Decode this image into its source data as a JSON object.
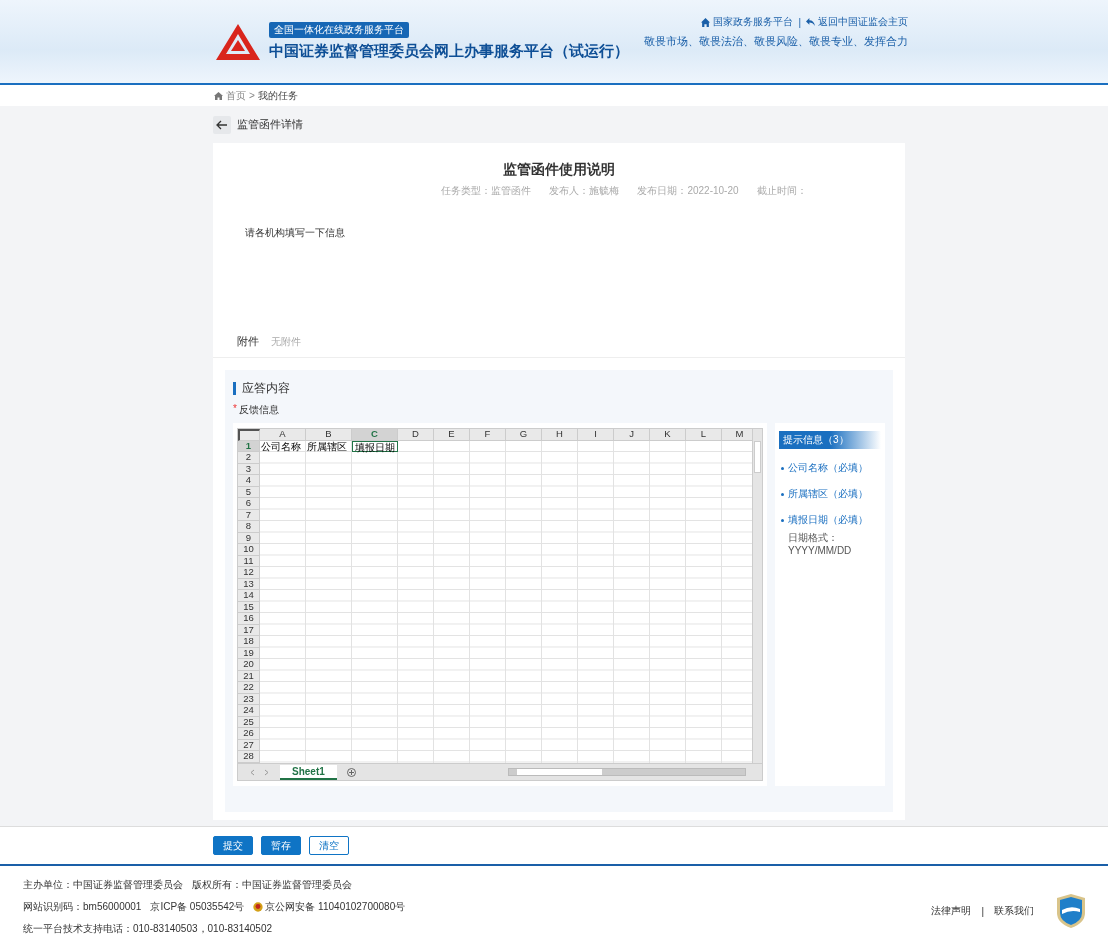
{
  "header": {
    "badge": "全国一体化在线政务服务平台",
    "title": "中国证券监督管理委员会网上办事服务平台（试运行）",
    "top_links": [
      {
        "text": "国家政务服务平台"
      },
      {
        "text": "返回中国证监会主页"
      }
    ],
    "link_separator": "|",
    "slogan": "敬畏市场、敬畏法治、敬畏风险、敬畏专业、发挥合力"
  },
  "breadcrumb": {
    "items": [
      "首页",
      "我的任务"
    ],
    "separator": ">"
  },
  "page_title": "监管函件详情",
  "notice": {
    "title": "监管函件使用说明",
    "meta": [
      "任务类型：监管函件",
      "发布人：施毓梅",
      "发布日期：2022-10-20",
      "截止时间："
    ],
    "body": "请各机构填写一下信息",
    "attachments_label": "附件",
    "attachments_value": "无附件"
  },
  "response": {
    "heading": "应答内容",
    "required_mark": "*",
    "field_label": "反馈信息",
    "sheet": {
      "columns": [
        "A",
        "B",
        "C",
        "D",
        "E",
        "F",
        "G",
        "H",
        "I",
        "J",
        "K",
        "L",
        "M"
      ],
      "rows": [
        {
          "header": "1",
          "cells": [
            {
              "text": "公司名称",
              "selected": false
            },
            {
              "text": "所属辖区",
              "selected": false
            },
            {
              "text": "填报日期",
              "selected": true
            }
          ]
        },
        {
          "header": "2",
          "cells": []
        },
        {
          "header": "3",
          "cells": []
        },
        {
          "header": "4",
          "cells": []
        },
        {
          "header": "5",
          "cells": []
        },
        {
          "header": "6",
          "cells": []
        },
        {
          "header": "7",
          "cells": []
        },
        {
          "header": "8",
          "cells": []
        },
        {
          "header": "9",
          "cells": []
        },
        {
          "header": "10",
          "cells": []
        },
        {
          "header": "11",
          "cells": []
        },
        {
          "header": "12",
          "cells": []
        },
        {
          "header": "13",
          "cells": []
        },
        {
          "header": "14",
          "cells": []
        },
        {
          "header": "15",
          "cells": []
        },
        {
          "header": "16",
          "cells": []
        },
        {
          "header": "17",
          "cells": []
        },
        {
          "header": "18",
          "cells": []
        },
        {
          "header": "19",
          "cells": []
        },
        {
          "header": "20",
          "cells": []
        },
        {
          "header": "21",
          "cells": []
        },
        {
          "header": "22",
          "cells": []
        },
        {
          "header": "23",
          "cells": []
        },
        {
          "header": "24",
          "cells": []
        },
        {
          "header": "25",
          "cells": []
        },
        {
          "header": "26",
          "cells": []
        },
        {
          "header": "27",
          "cells": []
        },
        {
          "header": "28",
          "cells": []
        }
      ],
      "tabs": [
        {
          "label": "Sheet1",
          "selected": true
        }
      ]
    },
    "hints": {
      "title": "提示信息（3）",
      "items": [
        {
          "text": "公司名称（必填）"
        },
        {
          "text": "所属辖区（必填）"
        },
        {
          "text": "填报日期（必填）",
          "note": "日期格式：YYYY/MM/DD"
        }
      ]
    }
  },
  "actions": [
    {
      "label": "提交",
      "kind": "primary"
    },
    {
      "label": "暂存",
      "kind": "primary"
    },
    {
      "label": "清空",
      "kind": "outline"
    }
  ],
  "footer": {
    "lines": [
      {
        "items": [
          {
            "text": "主办单位：中国证券监督管理委员会"
          },
          {
            "text": "版权所有：中国证券监督管理委员会"
          }
        ]
      },
      {
        "items": [
          {
            "text": "网站识别码：bm56000001"
          },
          {
            "text": "京ICP备 05035542号"
          },
          {
            "text": "京公网安备 11040102700080号",
            "kind": "emblem"
          }
        ]
      },
      {
        "items": [
          {
            "text": "统一平台技术支持电话：010-83140503，010-83140502"
          }
        ]
      }
    ],
    "links": [
      "法律声明",
      "联系我们"
    ],
    "link_separator": "|"
  }
}
